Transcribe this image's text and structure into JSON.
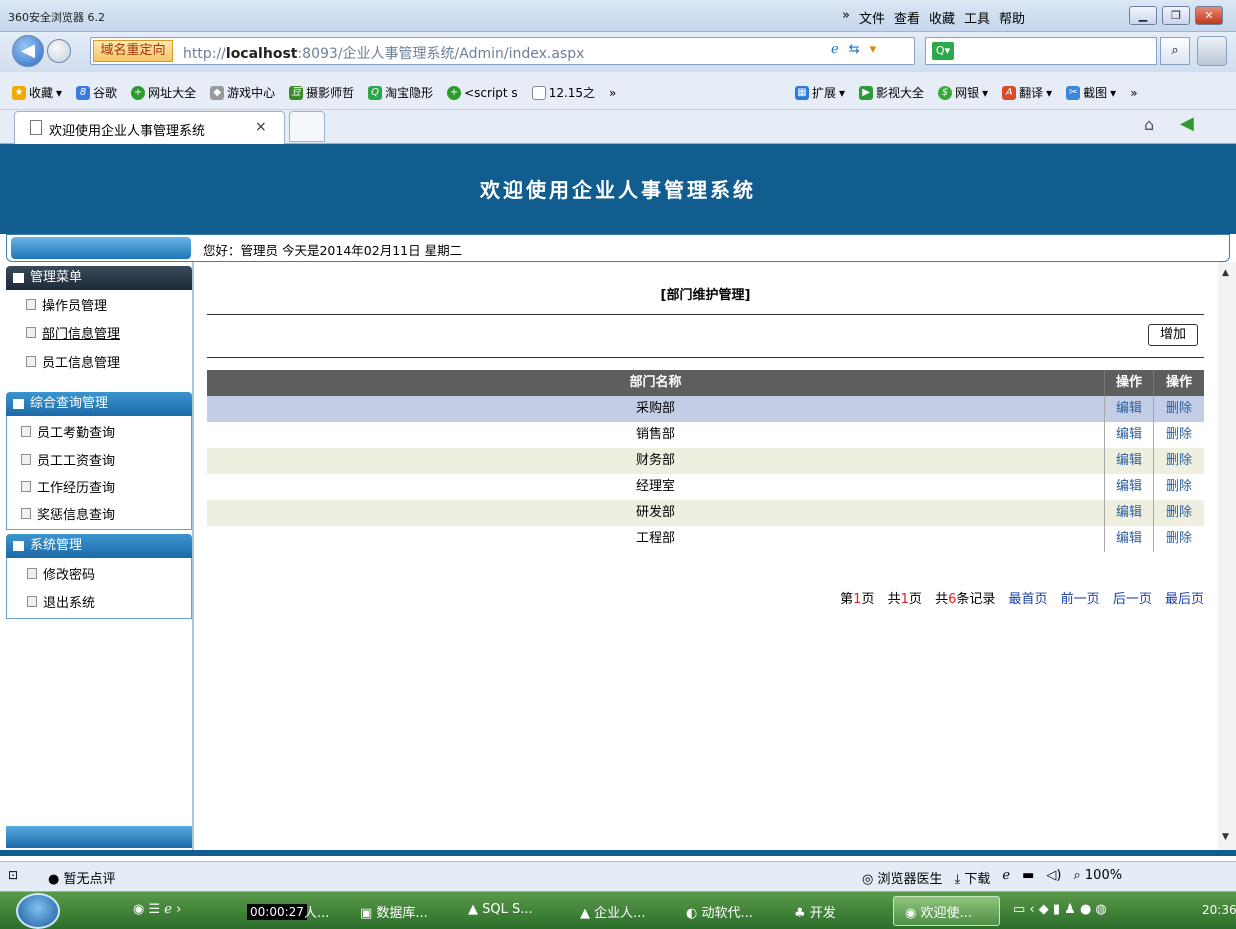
{
  "browser": {
    "app_title": "360安全浏览器 6.2",
    "menus": [
      "»",
      "文件",
      "查看",
      "收藏",
      "工具",
      "帮助"
    ],
    "redirect_label": "域名重定向",
    "url_prefix": "http://",
    "url_host": "localhost",
    "url_rest": ":8093/企业人事管理系统/Admin/index.aspx",
    "favorites": [
      "收藏",
      "谷歌",
      "网址大全",
      "游戏中心",
      "摄影师哲",
      "淘宝隐形",
      "<script s",
      "12.15之",
      "»"
    ],
    "extensions": [
      "扩展",
      "影视大全",
      "网银",
      "翻译",
      "截图",
      "»"
    ],
    "tab_title": "欢迎使用企业人事管理系统",
    "tab_close": "×"
  },
  "page": {
    "banner_title": "欢迎使用企业人事管理系统",
    "greeting": "您好：管理员  今天是2014年02月11日  星期二"
  },
  "sidebar": {
    "sections": [
      {
        "title": "管理菜单",
        "items": [
          "操作员管理",
          "部门信息管理",
          "员工信息管理"
        ]
      },
      {
        "title": "综合查询管理",
        "items": [
          "员工考勤查询",
          "员工工资查询",
          "工作经历查询",
          "奖惩信息查询"
        ]
      },
      {
        "title": "系统管理",
        "items": [
          "修改密码",
          "退出系统"
        ]
      }
    ]
  },
  "main": {
    "title": "[部门维护管理]",
    "add_button": "增加",
    "grid": {
      "headers": [
        "部门名称",
        "操作",
        "操作"
      ],
      "rows": [
        {
          "name": "采购部",
          "edit": "编辑",
          "delete": "删除",
          "bg": "#c4cde6"
        },
        {
          "name": "销售部",
          "edit": "编辑",
          "delete": "删除",
          "bg": "#ffffff"
        },
        {
          "name": "财务部",
          "edit": "编辑",
          "delete": "删除",
          "bg": "#efefdf"
        },
        {
          "name": "经理室",
          "edit": "编辑",
          "delete": "删除",
          "bg": "#ffffff"
        },
        {
          "name": "研发部",
          "edit": "编辑",
          "delete": "删除",
          "bg": "#efefdf"
        },
        {
          "name": "工程部",
          "edit": "编辑",
          "delete": "删除",
          "bg": "#ffffff"
        }
      ]
    },
    "pager": {
      "page_prefix": "第",
      "page_num": "1",
      "page_suffix": "页",
      "total_prefix": "共",
      "total_pages": "1",
      "total_suffix": "页",
      "rec_prefix": "共",
      "records": "6",
      "rec_suffix": "条记录",
      "first": "最首页",
      "prev": "前一页",
      "next": "后一页",
      "last": "最后页"
    }
  },
  "statusbar": {
    "rating": "暂无点评",
    "right_items": [
      "浏览器医生",
      "下载",
      "100%"
    ]
  },
  "taskbar": {
    "timer": "00:00:27",
    "items": [
      "人...",
      "数据库...",
      "SQL S...",
      "企业人...",
      "动软代...",
      "开发",
      "欢迎使..."
    ],
    "clock": "20:36"
  },
  "colors": {
    "banner": "#125d8f",
    "header_row": "#5e5e5e",
    "link": "#1a3ea8"
  }
}
